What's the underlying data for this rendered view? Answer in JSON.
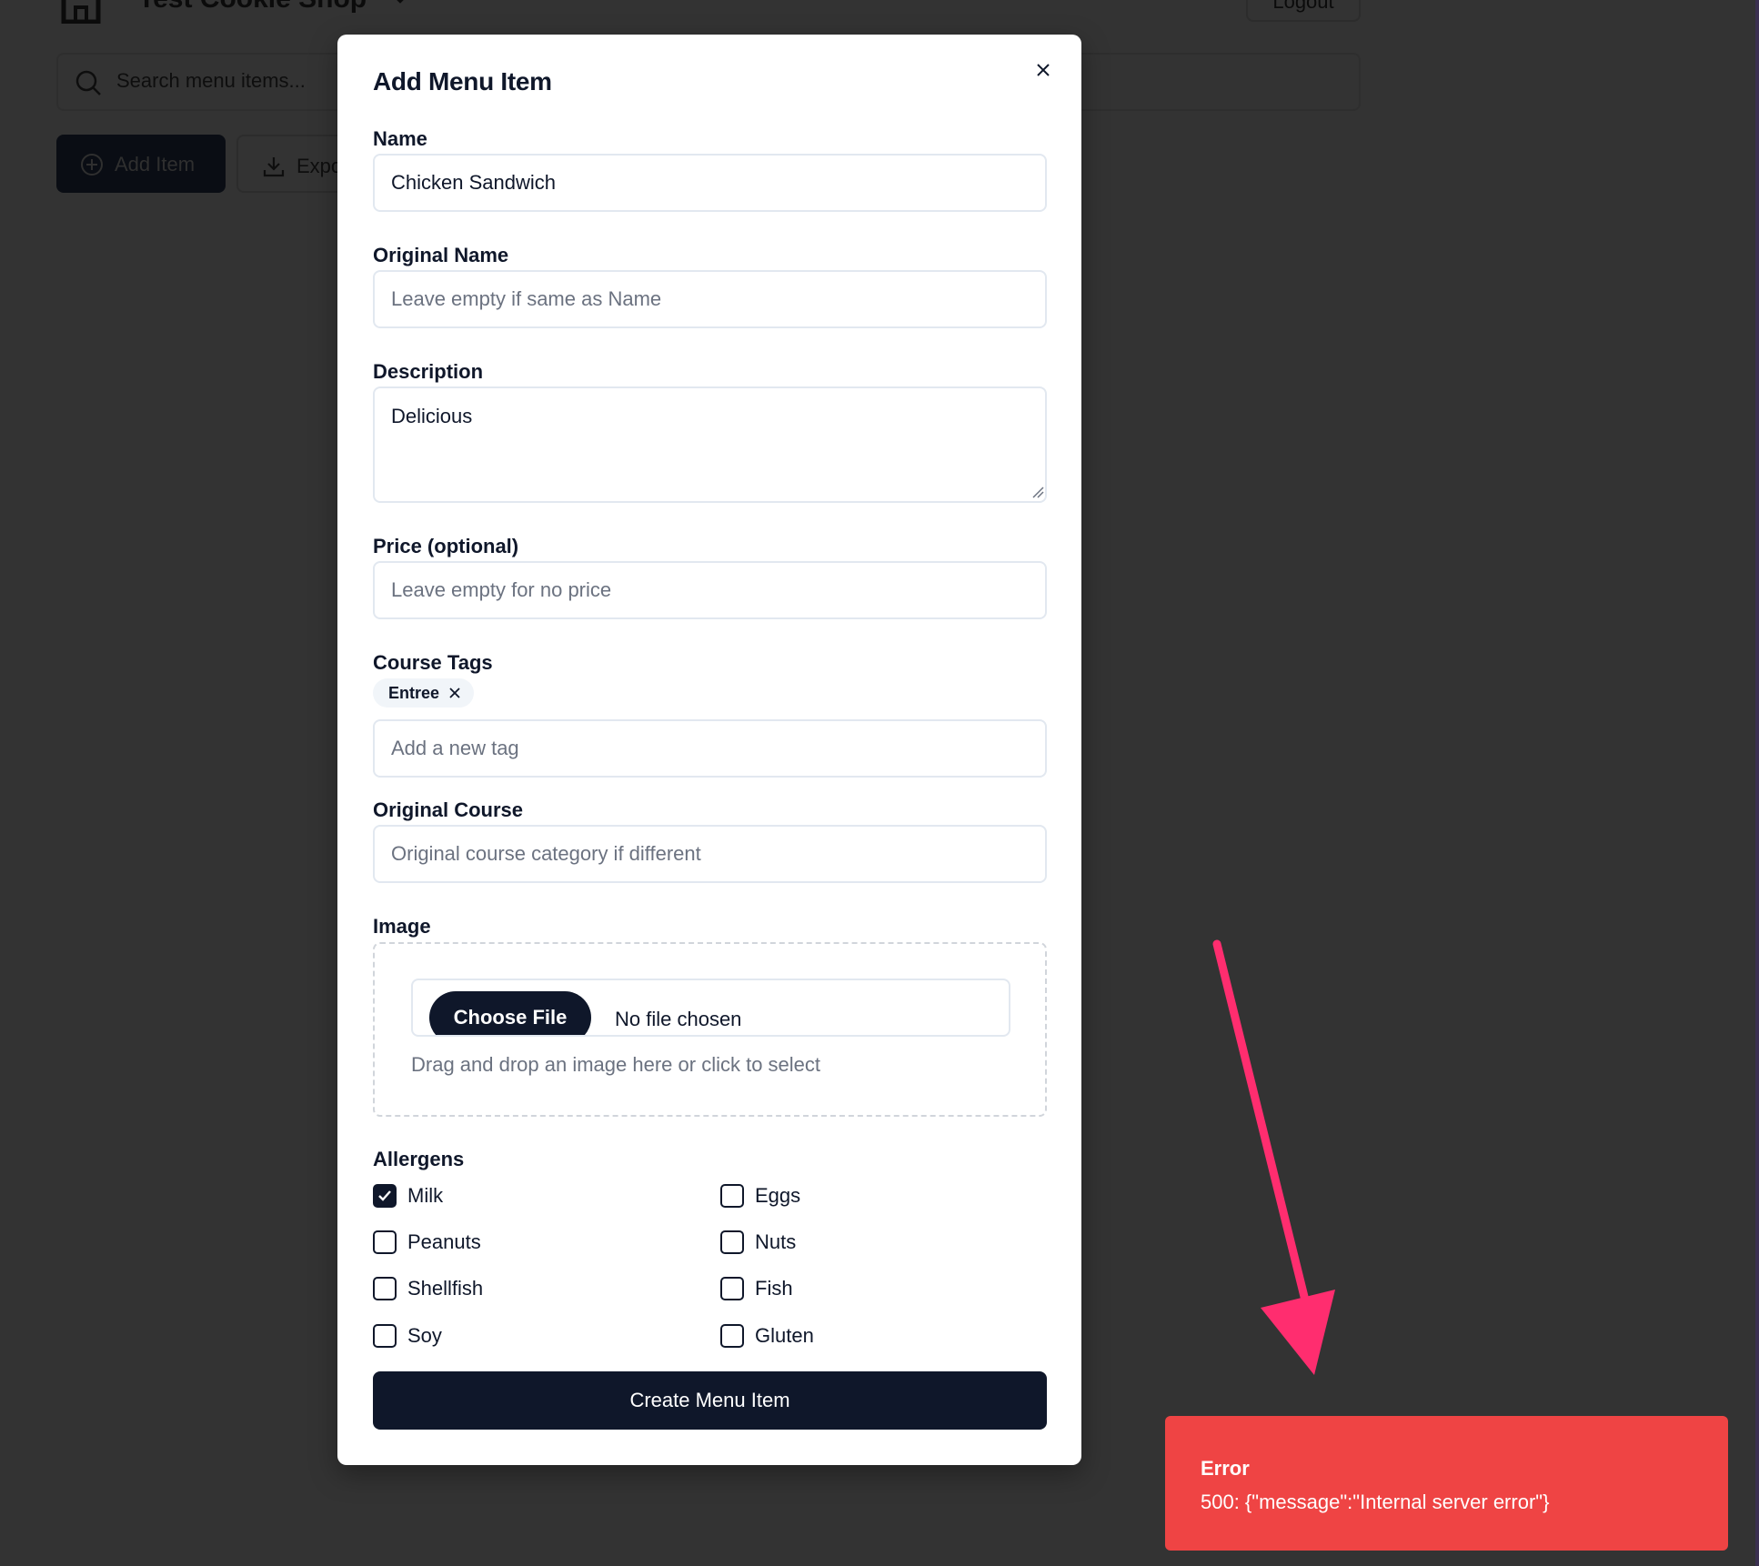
{
  "app": {
    "shop_name": "Test Cookie Shop",
    "logout_label": "Logout",
    "search_placeholder": "Search menu items...",
    "add_item_label": "Add Item",
    "export_label": "Expo"
  },
  "modal": {
    "title": "Add Menu Item",
    "fields": {
      "name": {
        "label": "Name",
        "value": "Chicken Sandwich"
      },
      "original_name": {
        "label": "Original Name",
        "placeholder": "Leave empty if same as Name"
      },
      "description": {
        "label": "Description",
        "value": "Delicious"
      },
      "price": {
        "label": "Price (optional)",
        "placeholder": "Leave empty for no price"
      },
      "course_tags": {
        "label": "Course Tags",
        "tags": [
          "Entree"
        ],
        "placeholder": "Add a new tag"
      },
      "original_course": {
        "label": "Original Course",
        "placeholder": "Original course category if different"
      },
      "image": {
        "label": "Image",
        "choose_file_label": "Choose File",
        "no_file_text": "No file chosen",
        "hint": "Drag and drop an image here or click to select"
      }
    },
    "allergens": {
      "label": "Allergens",
      "items": [
        {
          "label": "Milk",
          "checked": true
        },
        {
          "label": "Eggs",
          "checked": false
        },
        {
          "label": "Peanuts",
          "checked": false
        },
        {
          "label": "Nuts",
          "checked": false
        },
        {
          "label": "Shellfish",
          "checked": false
        },
        {
          "label": "Fish",
          "checked": false
        },
        {
          "label": "Soy",
          "checked": false
        },
        {
          "label": "Gluten",
          "checked": false
        }
      ]
    },
    "submit_label": "Create Menu Item"
  },
  "toast": {
    "title": "Error",
    "message": "500: {\"message\":\"Internal server error\"}"
  },
  "colors": {
    "overlay_bg": "#333333",
    "primary": "#0f172a",
    "toast_bg": "#ef4444",
    "arrow": "#ff2d6f"
  }
}
